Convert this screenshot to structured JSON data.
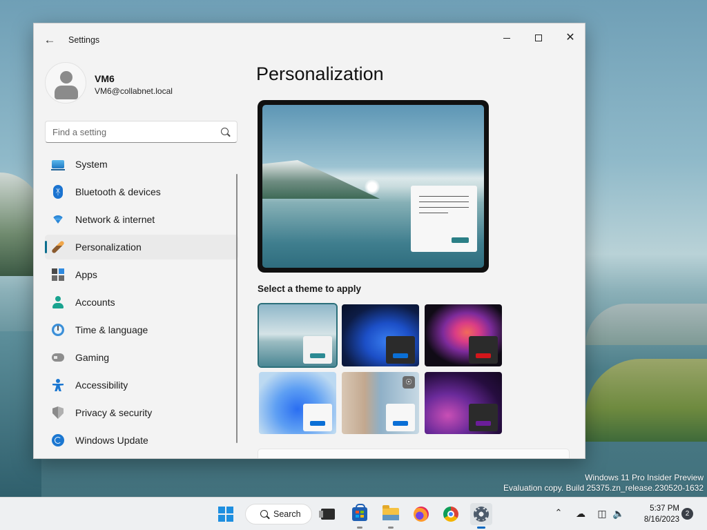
{
  "window": {
    "title": "Settings",
    "back_icon": "back-arrow-icon",
    "controls": {
      "minimize": "minimize-icon",
      "maximize": "maximize-icon",
      "close": "close-icon"
    }
  },
  "profile": {
    "name": "VM6",
    "email": "VM6@collabnet.local"
  },
  "search": {
    "placeholder": "Find a setting",
    "icon": "search-icon"
  },
  "sidebar": {
    "items": [
      {
        "label": "System",
        "icon": "system-icon"
      },
      {
        "label": "Bluetooth & devices",
        "icon": "bluetooth-icon"
      },
      {
        "label": "Network & internet",
        "icon": "wifi-icon"
      },
      {
        "label": "Personalization",
        "icon": "paintbrush-icon",
        "active": true
      },
      {
        "label": "Apps",
        "icon": "apps-icon"
      },
      {
        "label": "Accounts",
        "icon": "person-icon"
      },
      {
        "label": "Time & language",
        "icon": "clock-globe-icon"
      },
      {
        "label": "Gaming",
        "icon": "gamepad-icon"
      },
      {
        "label": "Accessibility",
        "icon": "accessibility-icon"
      },
      {
        "label": "Privacy & security",
        "icon": "shield-icon"
      },
      {
        "label": "Windows Update",
        "icon": "update-icon"
      }
    ]
  },
  "main": {
    "title": "Personalization",
    "theme_heading": "Select a theme to apply",
    "themes": [
      {
        "name": "theme-1",
        "selected": true,
        "accent": "#2b8a93"
      },
      {
        "name": "theme-2",
        "accent": "#0a6fd6"
      },
      {
        "name": "theme-3",
        "accent": "#d3161b"
      },
      {
        "name": "theme-4",
        "accent": "#0a6fd6"
      },
      {
        "name": "theme-5",
        "accent": "#0a6fd6"
      },
      {
        "name": "theme-6",
        "accent": "#6b1d9a"
      }
    ]
  },
  "watermark": {
    "line1": "Windows 11 Pro Insider Preview",
    "line2": "Evaluation copy. Build 25375.zn_release.230520-1632"
  },
  "taskbar": {
    "search_label": "Search",
    "apps": [
      "start-icon",
      "task-view-icon",
      "store-icon",
      "file-explorer-icon",
      "firefox-icon",
      "chrome-icon",
      "settings-icon"
    ],
    "tray": {
      "time": "5:37 PM",
      "date": "8/16/2023",
      "notifications": "2"
    }
  },
  "colors": {
    "accent": "#0b6e8e",
    "taskbar": "#eef0f2",
    "window_bg": "#f3f3f3"
  }
}
